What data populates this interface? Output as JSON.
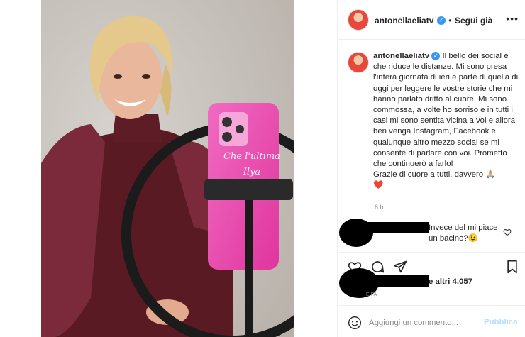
{
  "post": {
    "username": "antonellaeliatv",
    "follow_label": "Segui già",
    "caption_username": "antonellaeliatv",
    "caption_text": "Il bello dei social è che riduce le distanze. Mi sono presa l'intera giornata di ieri e parte di quella di oggi per leggere le vostre storie che mi hanno parlato dritto al cuore. Mi sono commossa, a volte ho sorriso e in tutti i casi mi sono sentita vicina a voi e allora ben venga Instagram, Facebook e qualunque altro mezzo social se mi consente di parlare con voi. Prometto che continuerò a farlo!",
    "caption_thanks": "Grazie di cuore a tutti, davvero 🙏🏼",
    "caption_heart": "❤️",
    "time_ago": "6 h",
    "photo_phone_text": "Che l'ultima Ilya"
  },
  "comments": [
    {
      "text": "Invece del mi piace un bacino?😉"
    }
  ],
  "likes": {
    "text": "e altri 4.057"
  },
  "date_label": "E FA",
  "add_comment": {
    "placeholder": "Aggiungi un commento...",
    "publish_label": "Pubblica"
  },
  "colors": {
    "verified": "#3897f0",
    "publish": "#b2dffc",
    "heart": "#ed4956"
  },
  "icons": [
    "verified-icon",
    "more-options-icon",
    "heart-icon",
    "comment-icon",
    "share-icon",
    "bookmark-icon",
    "emoji-icon",
    "like-comment-icon"
  ]
}
